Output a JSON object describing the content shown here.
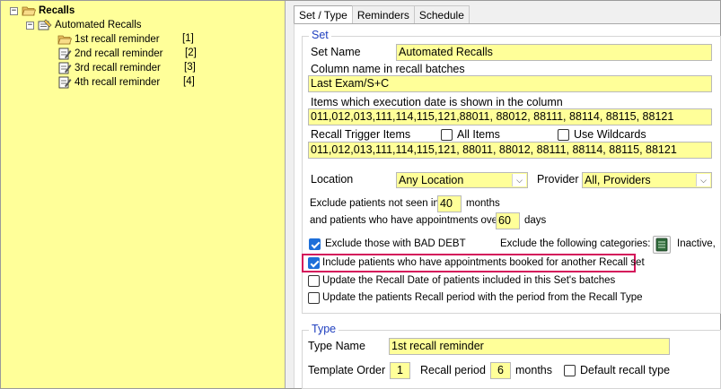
{
  "tree": {
    "root_label": "Recalls",
    "set_label": "Automated Recalls",
    "items": [
      {
        "label": "1st recall reminder",
        "count": "[1]"
      },
      {
        "label": "2nd recall reminder",
        "count": "[2]"
      },
      {
        "label": "3rd recall reminder",
        "count": "[3]"
      },
      {
        "label": "4th recall reminder",
        "count": "[4]"
      }
    ]
  },
  "tabs": [
    "Set / Type",
    "Reminders",
    "Schedule"
  ],
  "set": {
    "group_title": "Set",
    "set_name_label": "Set Name",
    "set_name_value": "Automated Recalls",
    "column_name_label": "Column name in recall batches",
    "column_name_value": "Last Exam/S+C",
    "items_label": "Items which execution date is shown in the column",
    "items_value": "011,012,013,111,114,115,121,88011, 88012, 88111, 88114, 88115, 88121",
    "trigger_label": "Recall Trigger Items",
    "all_items_label": "All Items",
    "wildcards_label": "Use Wildcards",
    "trigger_value": "011,012,013,111,114,115,121, 88011, 88012, 88111, 88114, 88115, 88121",
    "location_label": "Location",
    "location_value": "Any Location",
    "provider_label": "Provider",
    "provider_value": "All,   Providers",
    "exclude_not_seen_label": "Exclude patients not seen in",
    "exclude_not_seen_value": "40",
    "months_label": "months",
    "appointments_over_label": "and patients who have appointments over",
    "appointments_over_value": "60",
    "days_label": "days",
    "bad_debt_label": "Exclude those with BAD DEBT",
    "exclude_categories_label": "Exclude the following categories:",
    "categories_value": "Inactive,",
    "include_booked_label": "Include patients who have appointments booked for another Recall set",
    "update_recall_date_label": "Update the Recall Date of patients included in this Set's batches",
    "update_recall_period_label": "Update the patients Recall period with the period from the Recall Type"
  },
  "type": {
    "group_title": "Type",
    "type_name_label": "Type Name",
    "type_name_value": "1st recall reminder",
    "template_order_label": "Template Order",
    "template_order_value": "1",
    "recall_period_label": "Recall period",
    "recall_period_value": "6",
    "months_label": "months",
    "default_type_label": "Default recall type"
  },
  "colors": {
    "tree_bg": "#ffff99",
    "group_title": "#1f3fbf",
    "checkbox_on": "#1e6fd9",
    "highlight": "#d4145a"
  },
  "icons": [
    "open-folder-icon",
    "recall-set-icon",
    "document-pencil-icon",
    "category-list-icon",
    "dropdown-arrow-icon"
  ]
}
